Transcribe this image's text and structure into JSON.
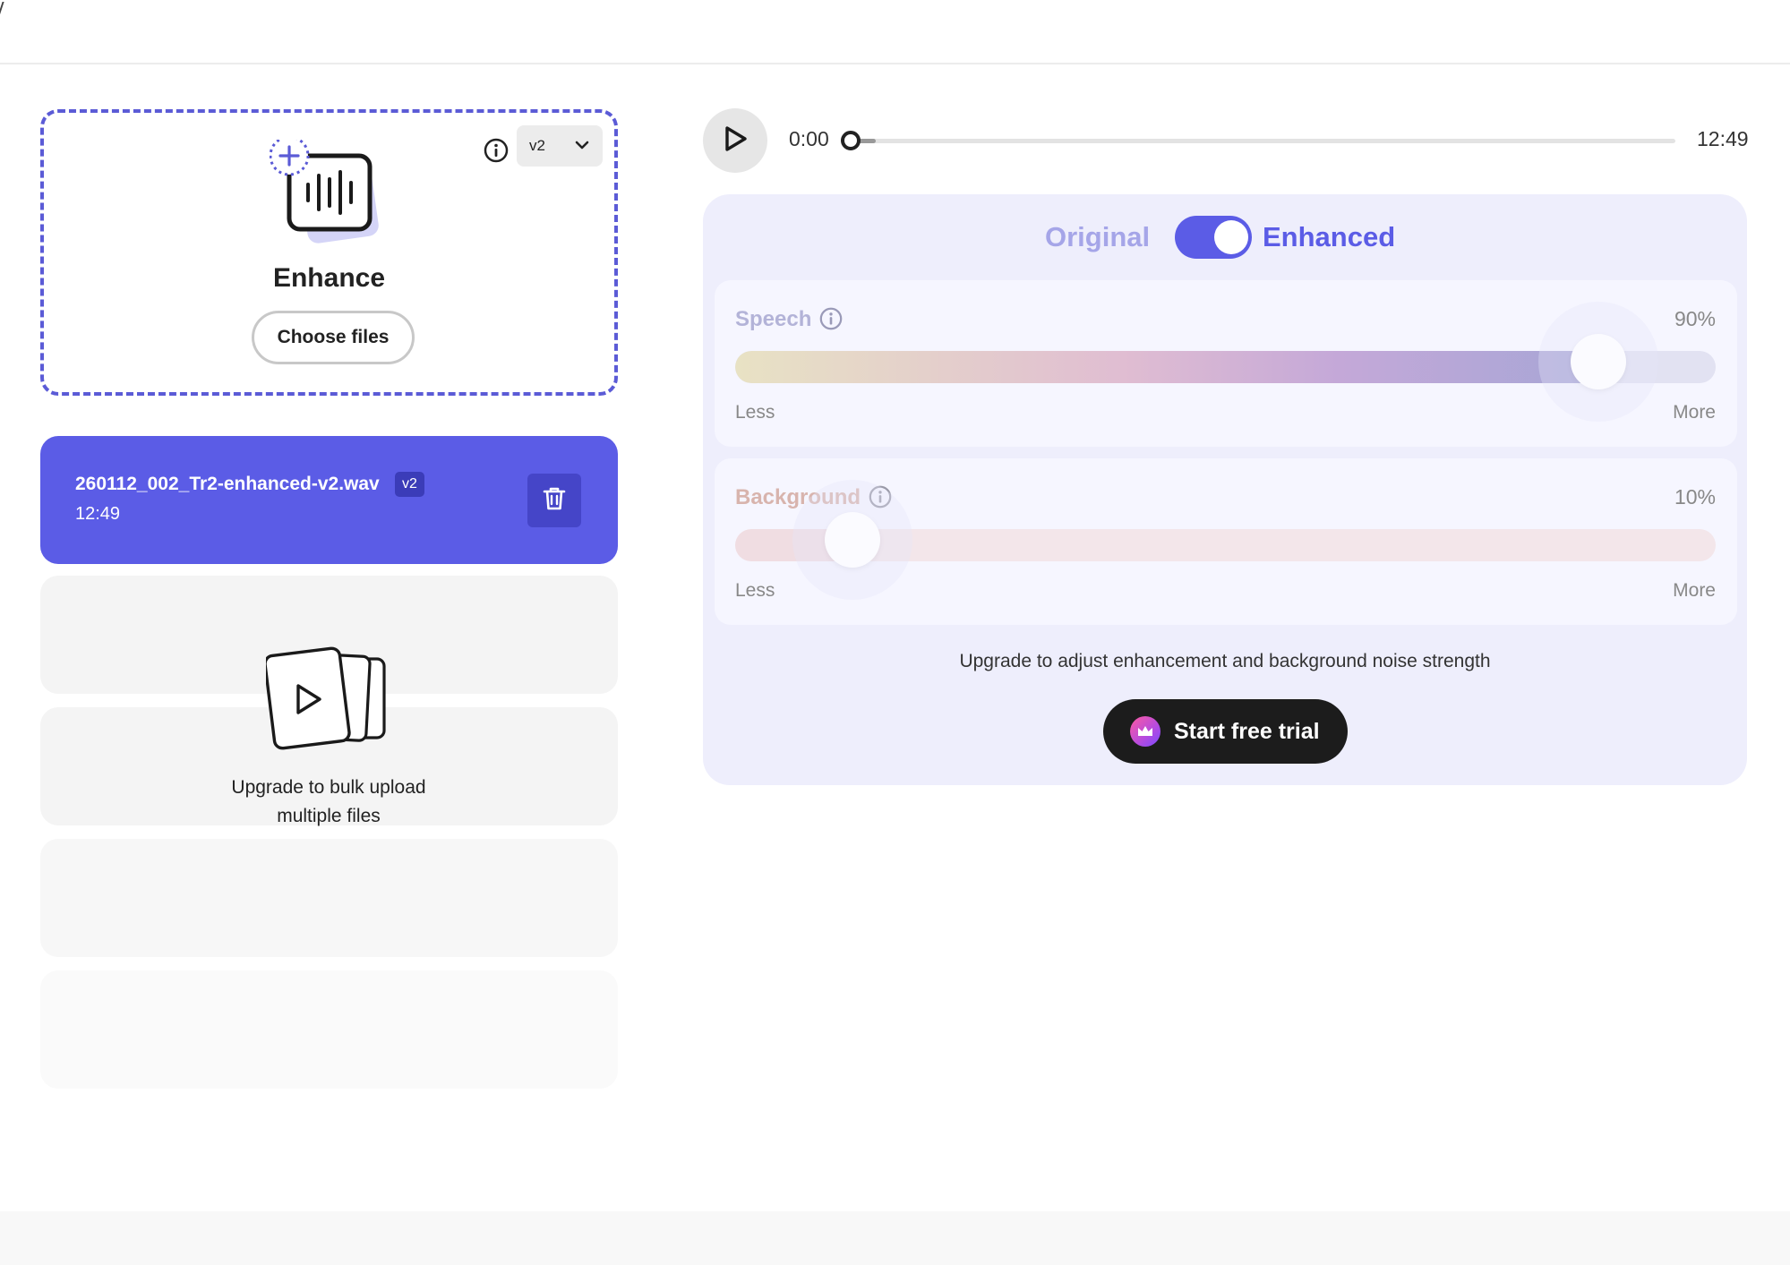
{
  "upload": {
    "title": "Enhance",
    "choose_label": "Choose files",
    "version": "v2"
  },
  "file": {
    "name": "260112_002_Tr2-enhanced-v2.wav",
    "version_badge": "v2",
    "duration": "12:49"
  },
  "bulk": {
    "line1": "Upgrade to bulk upload",
    "line2": "multiple files"
  },
  "player": {
    "current": "0:00",
    "total": "12:49",
    "progress": 0.03
  },
  "mode": {
    "original_label": "Original",
    "enhanced_label": "Enhanced",
    "enhanced_on": true
  },
  "speech": {
    "label": "Speech",
    "value_text": "90%",
    "value": 0.88,
    "less": "Less",
    "more": "More"
  },
  "background": {
    "label": "Background",
    "value_text": "10%",
    "value": 0.12,
    "less": "Less",
    "more": "More"
  },
  "upgrade": {
    "note": "Upgrade to adjust enhancement and background noise strength",
    "trial_label": "Start free trial"
  },
  "colors": {
    "accent": "#5b5ce6",
    "original_label": "#a5a5e8",
    "panel_bg": "#eeeefc",
    "trial_btn": "#1c1c1c"
  },
  "icons": {
    "dropzone_info": "info-icon",
    "version_chevron": "chevron-down-icon",
    "enhance": "audio-wave-add-icon",
    "delete": "trash-icon",
    "bulk": "stacked-video-files-icon",
    "play": "play-icon",
    "speech_info": "info-icon",
    "background_info": "info-icon",
    "trial": "crown-icon"
  }
}
